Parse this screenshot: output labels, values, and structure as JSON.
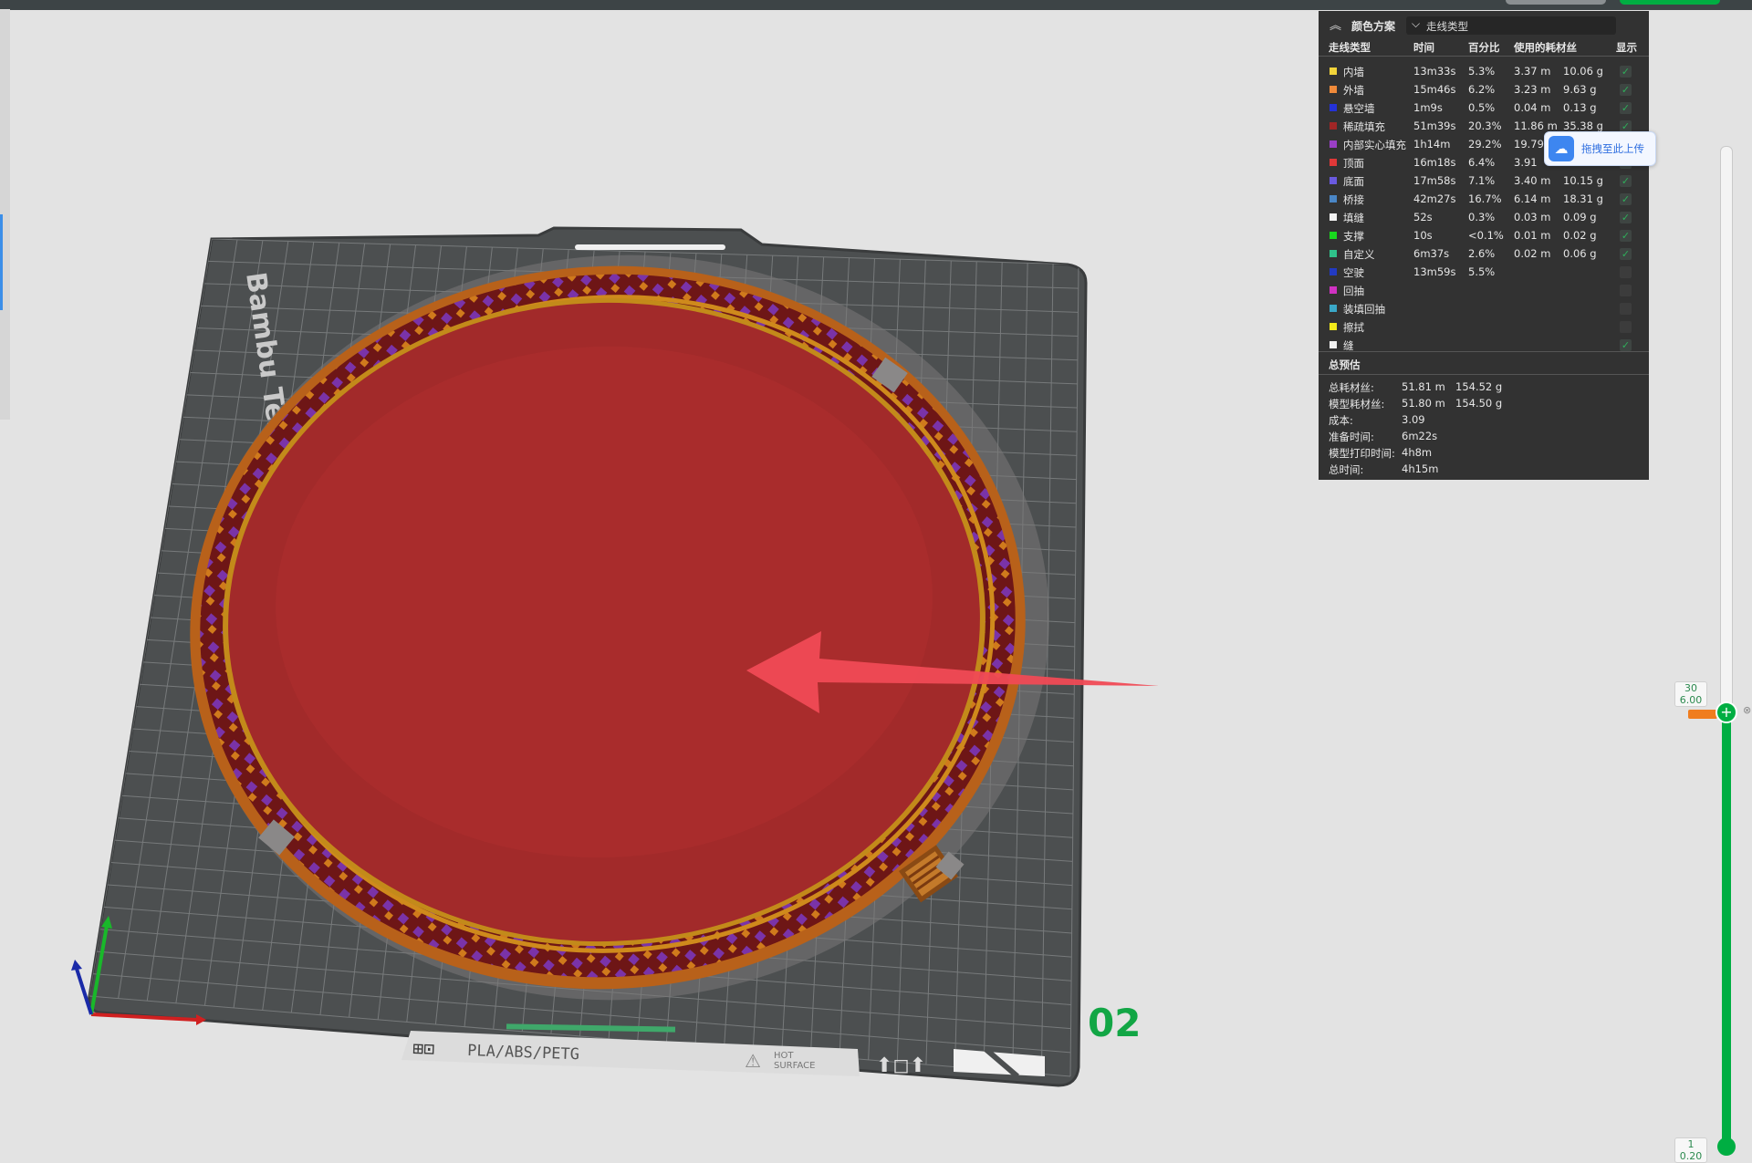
{
  "legend": {
    "title": "颜色方案",
    "view_type": "走线类型",
    "columns": [
      "走线类型",
      "时间",
      "百分比",
      "使用的耗材丝",
      "显示"
    ],
    "rows": [
      {
        "name": "内墙",
        "time": "13m33s",
        "percent": "5.3%",
        "length": "3.37 m",
        "weight": "10.06 g",
        "color": "#f2d43a",
        "shown": true
      },
      {
        "name": "外墙",
        "time": "15m46s",
        "percent": "6.2%",
        "length": "3.23 m",
        "weight": "9.63 g",
        "color": "#f08a3a",
        "shown": true
      },
      {
        "name": "悬空墙",
        "time": "1m9s",
        "percent": "0.5%",
        "length": "0.04 m",
        "weight": "0.13 g",
        "color": "#2432d8",
        "shown": true
      },
      {
        "name": "稀疏填充",
        "time": "51m39s",
        "percent": "20.3%",
        "length": "11.86 m",
        "weight": "35.38 g",
        "color": "#a02626",
        "shown": true
      },
      {
        "name": "内部实心填充",
        "time": "1h14m",
        "percent": "29.2%",
        "length": "19.79",
        "weight": "",
        "color": "#9a3fc6",
        "shown": true
      },
      {
        "name": "顶面",
        "time": "16m18s",
        "percent": "6.4%",
        "length": "3.91",
        "weight": "",
        "color": "#e03838",
        "shown": true
      },
      {
        "name": "底面",
        "time": "17m58s",
        "percent": "7.1%",
        "length": "3.40 m",
        "weight": "10.15 g",
        "color": "#6a5ae0",
        "shown": true
      },
      {
        "name": "桥接",
        "time": "42m27s",
        "percent": "16.7%",
        "length": "6.14 m",
        "weight": "18.31 g",
        "color": "#4a86c6",
        "shown": true
      },
      {
        "name": "填缝",
        "time": "52s",
        "percent": "0.3%",
        "length": "0.03 m",
        "weight": "0.09 g",
        "color": "#f2f2f2",
        "shown": true
      },
      {
        "name": "支撑",
        "time": "10s",
        "percent": "<0.1%",
        "length": "0.01 m",
        "weight": "0.02 g",
        "color": "#18d81e",
        "shown": true
      },
      {
        "name": "自定义",
        "time": "6m37s",
        "percent": "2.6%",
        "length": "0.02 m",
        "weight": "0.06 g",
        "color": "#2fc28a",
        "shown": true
      },
      {
        "name": "空驶",
        "time": "13m59s",
        "percent": "5.5%",
        "length": "",
        "weight": "",
        "color": "#223ac2",
        "shown": false
      },
      {
        "name": "回抽",
        "time": "",
        "percent": "",
        "length": "",
        "weight": "",
        "color": "#d032c2",
        "shown": false
      },
      {
        "name": "装填回抽",
        "time": "",
        "percent": "",
        "length": "",
        "weight": "",
        "color": "#3aa8c8",
        "shown": false
      },
      {
        "name": "擦拭",
        "time": "",
        "percent": "",
        "length": "",
        "weight": "",
        "color": "#f2ea1a",
        "shown": false
      },
      {
        "name": "缝",
        "time": "",
        "percent": "",
        "length": "",
        "weight": "",
        "color": "#f0f0f0",
        "shown": true
      }
    ],
    "summary_title": "总预估",
    "summary": [
      {
        "label": "总耗材丝:",
        "v1": "51.81 m",
        "v2": "154.52 g"
      },
      {
        "label": "模型耗材丝:",
        "v1": "51.80 m",
        "v2": "154.50 g"
      },
      {
        "label": "成本:",
        "v1": "3.09",
        "v2": ""
      },
      {
        "label": "准备时间:",
        "v1": "6m22s",
        "v2": ""
      },
      {
        "label": "模型打印时间:",
        "v1": "4h8m",
        "v2": ""
      },
      {
        "label": "总时间:",
        "v1": "4h15m",
        "v2": ""
      }
    ]
  },
  "upload_tooltip": "拖拽至此上传",
  "slider": {
    "top_layer": "30",
    "top_height": "6.00",
    "bottom_layer": "1",
    "bottom_height": "0.20",
    "accent": "#00ae42"
  },
  "plate": {
    "label": "Bambu Textured",
    "number": "02",
    "materials": "PLA/ABS/PETG",
    "hot1": "HOT",
    "hot2": "SURFACE"
  }
}
